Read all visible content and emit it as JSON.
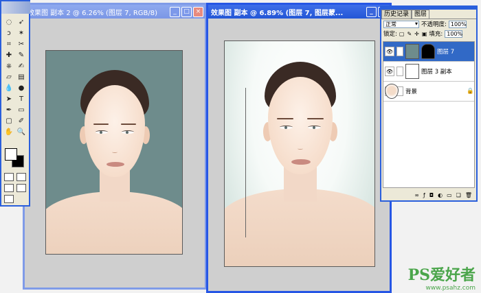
{
  "left_window": {
    "title": "效果图 副本 2 @ 6.26% (图层 7, RGB/8)"
  },
  "right_window": {
    "title": "效果图 副本 @ 6.89% (图层 7, 图层蒙..."
  },
  "window_buttons": {
    "minimize": "_",
    "maximize": "□",
    "close": "×"
  },
  "toolbox": {
    "tools": [
      "marquee-icon",
      "move-icon",
      "lasso-icon",
      "magic-wand-icon",
      "crop-icon",
      "slice-icon",
      "healing-icon",
      "brush-icon",
      "stamp-icon",
      "history-brush-icon",
      "eraser-icon",
      "gradient-icon",
      "blur-icon",
      "dodge-icon",
      "path-select-icon",
      "type-icon",
      "pen-icon",
      "shape-icon",
      "notes-icon",
      "eyedropper-icon",
      "hand-icon",
      "zoom-icon"
    ],
    "glyphs": [
      "◌",
      "➶",
      "ↄ",
      "✶",
      "⌗",
      "✂",
      "✚",
      "✎",
      "⎈",
      "✍",
      "▱",
      "▤",
      "💧",
      "●",
      "➤",
      "T",
      "✒",
      "▭",
      "▢",
      "✐",
      "✋",
      "🔍"
    ],
    "colors": {
      "foreground": "#ffffff",
      "background": "#000000"
    }
  },
  "layers_panel": {
    "tabs": [
      {
        "label": "历史记录"
      },
      {
        "label": "图层"
      }
    ],
    "blend_mode": "正常",
    "opacity_label": "不透明度:",
    "opacity_value": "100%",
    "lock_label": "锁定:",
    "fill_label": "填充:",
    "fill_value": "100%",
    "layers": [
      {
        "name": "图层 7",
        "selected": true
      },
      {
        "name": "图层 3 副本",
        "selected": false
      },
      {
        "name": "背景",
        "selected": false
      }
    ],
    "footer_icons": [
      "link-layers-icon",
      "layer-style-icon",
      "mask-icon",
      "adjustment-icon",
      "group-icon",
      "new-layer-icon",
      "trash-icon"
    ]
  },
  "watermark": {
    "brand": "PS爱好者",
    "url": "www.psahz.com"
  }
}
